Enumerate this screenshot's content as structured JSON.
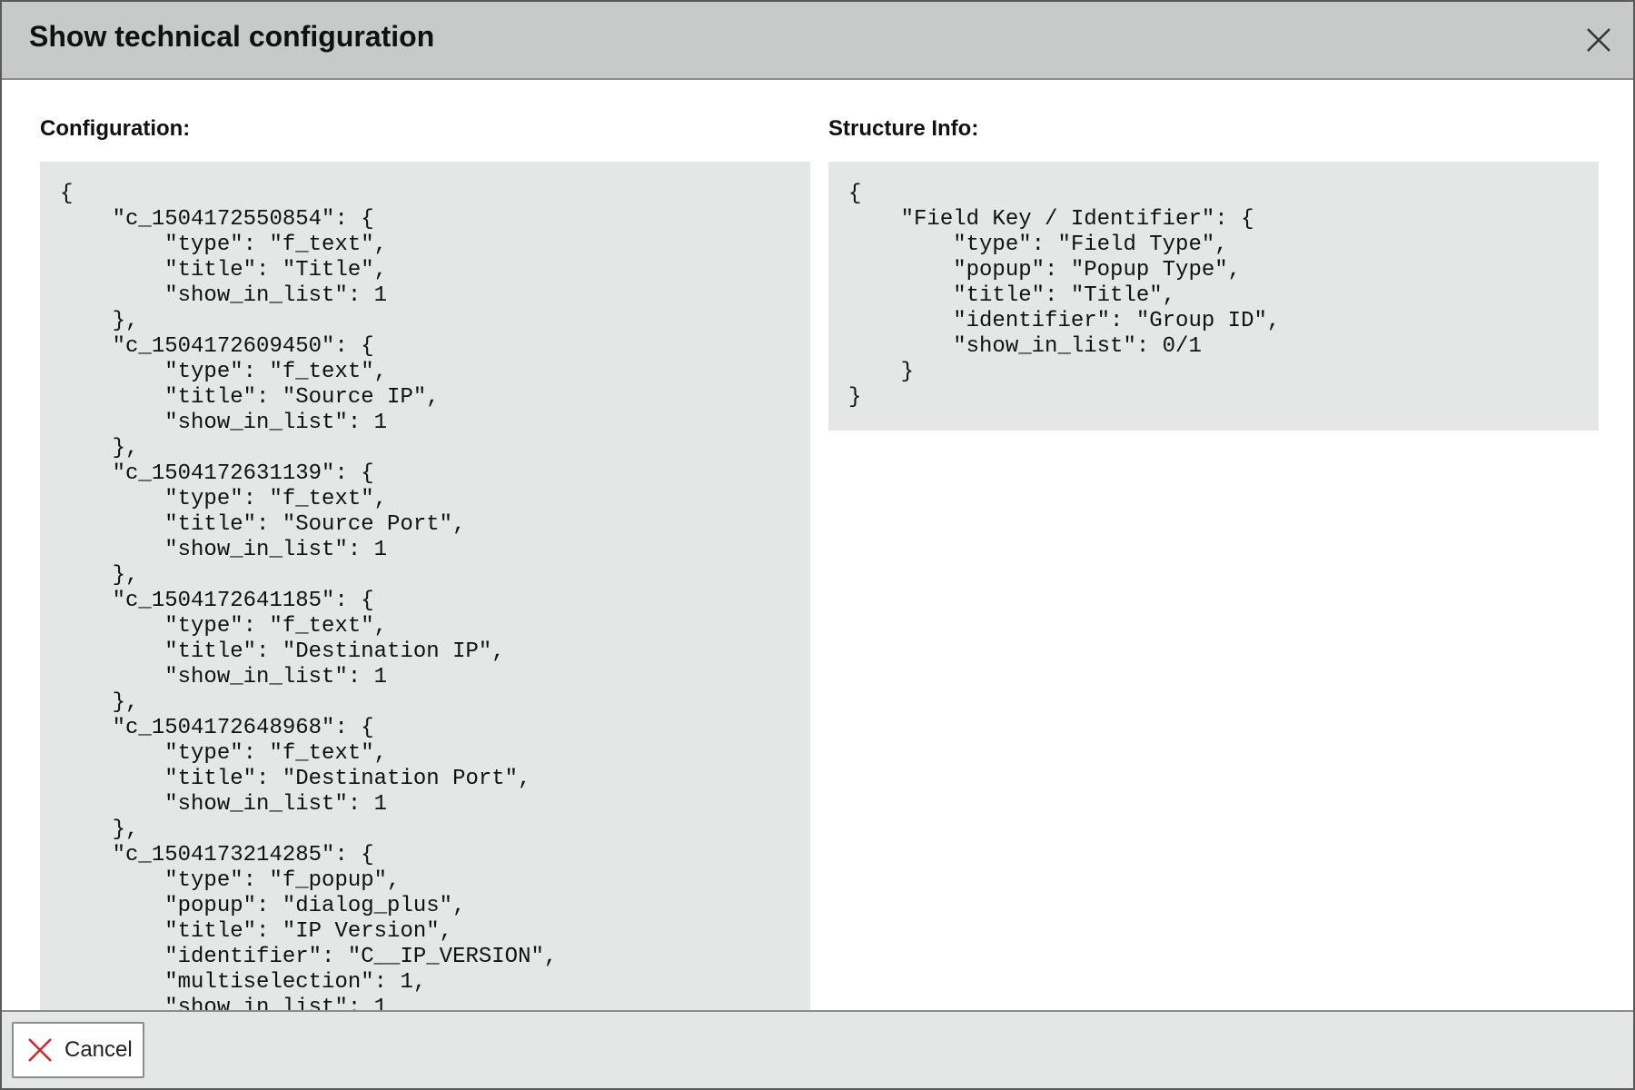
{
  "dialog": {
    "title": "Show technical configuration",
    "close_icon": "close-icon"
  },
  "configuration": {
    "label": "Configuration:",
    "code": "{\n    \"c_1504172550854\": {\n        \"type\": \"f_text\",\n        \"title\": \"Title\",\n        \"show_in_list\": 1\n    },\n    \"c_1504172609450\": {\n        \"type\": \"f_text\",\n        \"title\": \"Source IP\",\n        \"show_in_list\": 1\n    },\n    \"c_1504172631139\": {\n        \"type\": \"f_text\",\n        \"title\": \"Source Port\",\n        \"show_in_list\": 1\n    },\n    \"c_1504172641185\": {\n        \"type\": \"f_text\",\n        \"title\": \"Destination IP\",\n        \"show_in_list\": 1\n    },\n    \"c_1504172648968\": {\n        \"type\": \"f_text\",\n        \"title\": \"Destination Port\",\n        \"show_in_list\": 1\n    },\n    \"c_1504173214285\": {\n        \"type\": \"f_popup\",\n        \"popup\": \"dialog_plus\",\n        \"title\": \"IP Version\",\n        \"identifier\": \"C__IP_VERSION\",\n        \"multiselection\": 1,\n        \"show_in_list\": 1"
  },
  "structure_info": {
    "label": "Structure Info:",
    "code": "{\n    \"Field Key / Identifier\": {\n        \"type\": \"Field Type\",\n        \"popup\": \"Popup Type\",\n        \"title\": \"Title\",\n        \"identifier\": \"Group ID\",\n        \"show_in_list\": 0/1\n    }\n}"
  },
  "footer": {
    "cancel_label": "Cancel",
    "cancel_icon": "close-icon"
  },
  "colors": {
    "titlebar": "#c8c9c9",
    "code_background": "#e5e6e6",
    "cancel_icon": "#d9232a"
  }
}
